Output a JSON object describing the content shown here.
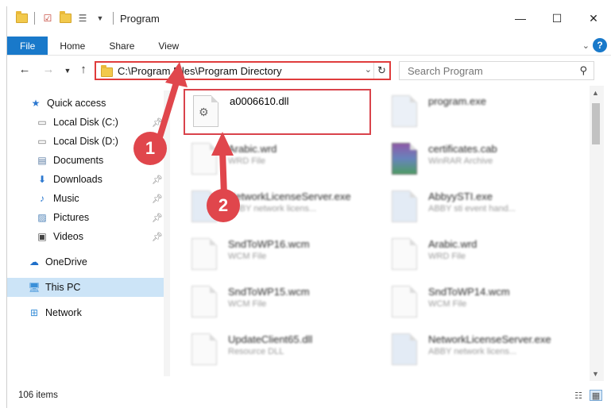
{
  "window": {
    "title": "Program",
    "controls": {
      "minimize": "—",
      "maximize": "☐",
      "close": "✕"
    }
  },
  "ribbon": {
    "tabs": [
      "File",
      "Home",
      "Share",
      "View"
    ],
    "expand_glyph": "⌄",
    "help_glyph": "?"
  },
  "address": {
    "path": "C:\\Program Files\\Program Directory",
    "refresh_glyph": "↻"
  },
  "search": {
    "placeholder": "Search Program"
  },
  "sidebar": {
    "items": [
      {
        "label": "Quick access",
        "icon": "star-icon"
      },
      {
        "label": "Local Disk (C:)",
        "icon": "drive-icon",
        "pinned": true
      },
      {
        "label": "Local Disk (D:)",
        "icon": "drive-icon"
      },
      {
        "label": "Documents",
        "icon": "documents-icon",
        "pinned": true
      },
      {
        "label": "Downloads",
        "icon": "download-icon",
        "pinned": true
      },
      {
        "label": "Music",
        "icon": "music-icon",
        "pinned": true
      },
      {
        "label": "Pictures",
        "icon": "pictures-icon",
        "pinned": true
      },
      {
        "label": "Videos",
        "icon": "videos-icon",
        "pinned": true
      },
      {
        "label": "OneDrive",
        "icon": "cloud-icon"
      },
      {
        "label": "This PC",
        "icon": "computer-icon",
        "selected": true
      },
      {
        "label": "Network",
        "icon": "network-icon"
      }
    ]
  },
  "files": [
    {
      "name": "a0006610.dll",
      "type": "",
      "highlighted": true
    },
    {
      "name": "program.exe",
      "type": ""
    },
    {
      "name": "Arabic.wrd",
      "type": "WRD File"
    },
    {
      "name": "certificates.cab",
      "type": "WinRAR Archive"
    },
    {
      "name": "NetworkLicenseServer.exe",
      "type": "ABBY network licens..."
    },
    {
      "name": "AbbyySTI.exe",
      "type": "ABBY sti event hand..."
    },
    {
      "name": "SndToWP16.wcm",
      "type": "WCM File"
    },
    {
      "name": "Arabic.wrd",
      "type": "WRD File"
    },
    {
      "name": "SndToWP15.wcm",
      "type": "WCM File"
    },
    {
      "name": "SndToWP14.wcm",
      "type": "WCM File"
    },
    {
      "name": "UpdateClient65.dll",
      "type": "Resource DLL"
    },
    {
      "name": "NetworkLicenseServer.exe",
      "type": "ABBY network licens..."
    }
  ],
  "status": {
    "item_count": "106 items"
  },
  "callouts": [
    "1",
    "2"
  ],
  "colors": {
    "accent": "#1979ca",
    "highlight": "#e03c3c",
    "callout": "#e0464c",
    "selected_nav": "#cce4f7"
  }
}
